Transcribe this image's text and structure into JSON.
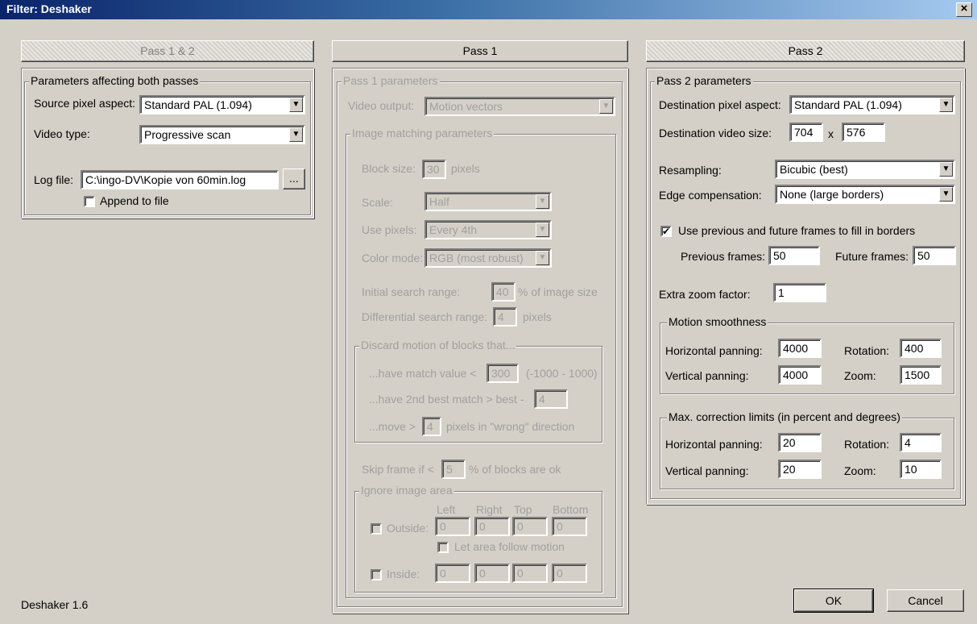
{
  "window": {
    "title": "Filter: Deshaker",
    "close": "×"
  },
  "tabs": {
    "pass12": "Pass 1 & 2",
    "pass1": "Pass 1",
    "pass2": "Pass 2"
  },
  "both": {
    "group": "Parameters affecting both passes",
    "source_aspect_label": "Source pixel aspect:",
    "source_aspect_value": "Standard PAL (1.094)",
    "video_type_label": "Video type:",
    "video_type_value": "Progressive scan",
    "log_file_label": "Log file:",
    "log_file_value": "C:\\ingo-DV\\Kopie von 60min.log",
    "browse": "...",
    "append_label": "Append to file",
    "append_checked": false
  },
  "pass1": {
    "group": "Pass 1 parameters",
    "video_output_label": "Video output:",
    "video_output_value": "Motion vectors",
    "match_group": "Image matching parameters",
    "block_size_label": "Block size:",
    "block_size_value": "30",
    "block_size_unit": "pixels",
    "scale_label": "Scale:",
    "scale_value": "Half",
    "use_pixels_label": "Use pixels:",
    "use_pixels_value": "Every 4th",
    "color_mode_label": "Color mode:",
    "color_mode_value": "RGB  (most robust)",
    "initial_range_label": "Initial search range:",
    "initial_range_value": "40",
    "initial_range_unit": "% of image size",
    "diff_range_label": "Differential search range:",
    "diff_range_value": "4",
    "diff_range_unit": "pixels",
    "discard_group": "Discard motion of blocks that...",
    "match_value_label": "...have match value <",
    "match_value_value": "300",
    "match_value_range": "(-1000 - 1000)",
    "second_best_label": "...have 2nd best match > best -",
    "second_best_value": "4",
    "move_label": "...move >",
    "move_value": "4",
    "move_unit": "pixels in \"wrong\" direction",
    "skip_label": "Skip frame if <",
    "skip_value": "5",
    "skip_unit": "% of blocks are ok",
    "ignore_group": "Ignore image area",
    "col_left": "Left",
    "col_right": "Right",
    "col_top": "Top",
    "col_bottom": "Bottom",
    "outside_label": "Outside:",
    "outside_values": [
      "0",
      "0",
      "0",
      "0"
    ],
    "follow_label": "Let area follow motion",
    "inside_label": "Inside:",
    "inside_values": [
      "0",
      "0",
      "0",
      "0"
    ]
  },
  "pass2": {
    "group": "Pass 2 parameters",
    "dest_aspect_label": "Destination pixel aspect:",
    "dest_aspect_value": "Standard PAL (1.094)",
    "dest_size_label": "Destination video size:",
    "dest_width": "704",
    "dest_x": "x",
    "dest_height": "576",
    "resampling_label": "Resampling:",
    "resampling_value": "Bicubic  (best)",
    "edge_label": "Edge compensation:",
    "edge_value": "None  (large borders)",
    "use_frames_label": "Use previous and future frames to fill in borders",
    "use_frames_checked": true,
    "prev_frames_label": "Previous frames:",
    "prev_frames_value": "50",
    "future_frames_label": "Future frames:",
    "future_frames_value": "50",
    "zoom_factor_label": "Extra zoom factor:",
    "zoom_factor_value": "1",
    "smooth_group": "Motion smoothness",
    "smooth_h_label": "Horizontal panning:",
    "smooth_h_value": "4000",
    "smooth_rot_label": "Rotation:",
    "smooth_rot_value": "400",
    "smooth_v_label": "Vertical panning:",
    "smooth_v_value": "4000",
    "smooth_zoom_label": "Zoom:",
    "smooth_zoom_value": "1500",
    "limits_group": "Max. correction limits (in percent and degrees)",
    "lim_h_label": "Horizontal panning:",
    "lim_h_value": "20",
    "lim_rot_label": "Rotation:",
    "lim_rot_value": "4",
    "lim_v_label": "Vertical panning:",
    "lim_v_value": "20",
    "lim_zoom_label": "Zoom:",
    "lim_zoom_value": "10"
  },
  "footer": {
    "version": "Deshaker 1.6",
    "ok": "OK",
    "cancel": "Cancel"
  }
}
